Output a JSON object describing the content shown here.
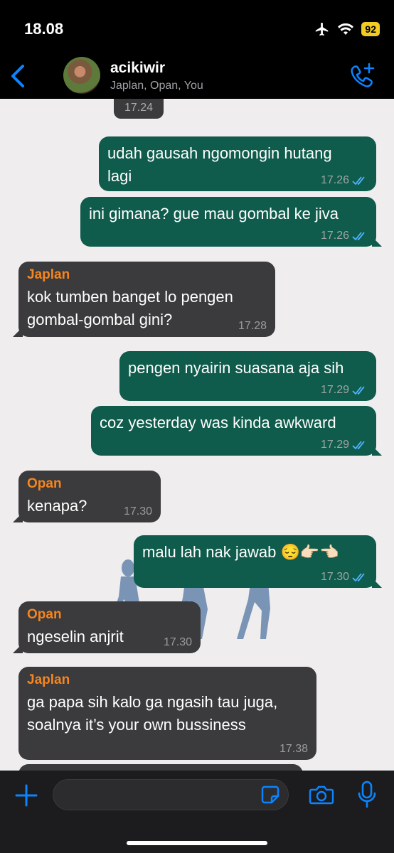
{
  "status": {
    "time": "18.08",
    "battery": "92"
  },
  "header": {
    "name": "acikiwir",
    "members": "Japlan, Opan, You"
  },
  "chip": "17.24",
  "messages": [
    {
      "dir": "out",
      "text": "udah gausah ngomongin hutang\nlagi",
      "time": "17.26"
    },
    {
      "dir": "out",
      "text": "ini gimana? gue mau gombal ke jiva",
      "time": "17.26"
    },
    {
      "dir": "in",
      "sender": "Japlan",
      "text": "kok tumben banget lo pengen\ngombal-gombal gini?",
      "time": "17.28"
    },
    {
      "dir": "out",
      "text": "pengen nyairin suasana aja sih",
      "time": "17.29"
    },
    {
      "dir": "out",
      "text": "coz yesterday was kinda awkward",
      "time": "17.29"
    },
    {
      "dir": "in",
      "sender": "Opan",
      "text": "kenapa?",
      "time": "17.30"
    },
    {
      "dir": "out",
      "text": "malu lah nak jawab 😔👉🏻👈🏻",
      "time": "17.30"
    },
    {
      "dir": "in",
      "sender": "Opan",
      "text": "ngeselin anjrit",
      "time": "17.30"
    },
    {
      "dir": "in",
      "sender": "Japlan",
      "text": "ga papa sih kalo ga ngasih tau juga,\nsoalnya it’s your own bussiness",
      "time": "17.38"
    }
  ],
  "icons": {
    "back": "chevron-left-icon",
    "call": "phone-plus-icon",
    "plus": "plus-icon",
    "sticker": "sticker-icon",
    "camera": "camera-icon",
    "mic": "microphone-icon",
    "read": "double-check-icon"
  },
  "colors": {
    "accent": "#0a84ff",
    "outgoing": "#0f5b4c",
    "incoming": "#3b3a3c",
    "sender": "#f5861f"
  }
}
